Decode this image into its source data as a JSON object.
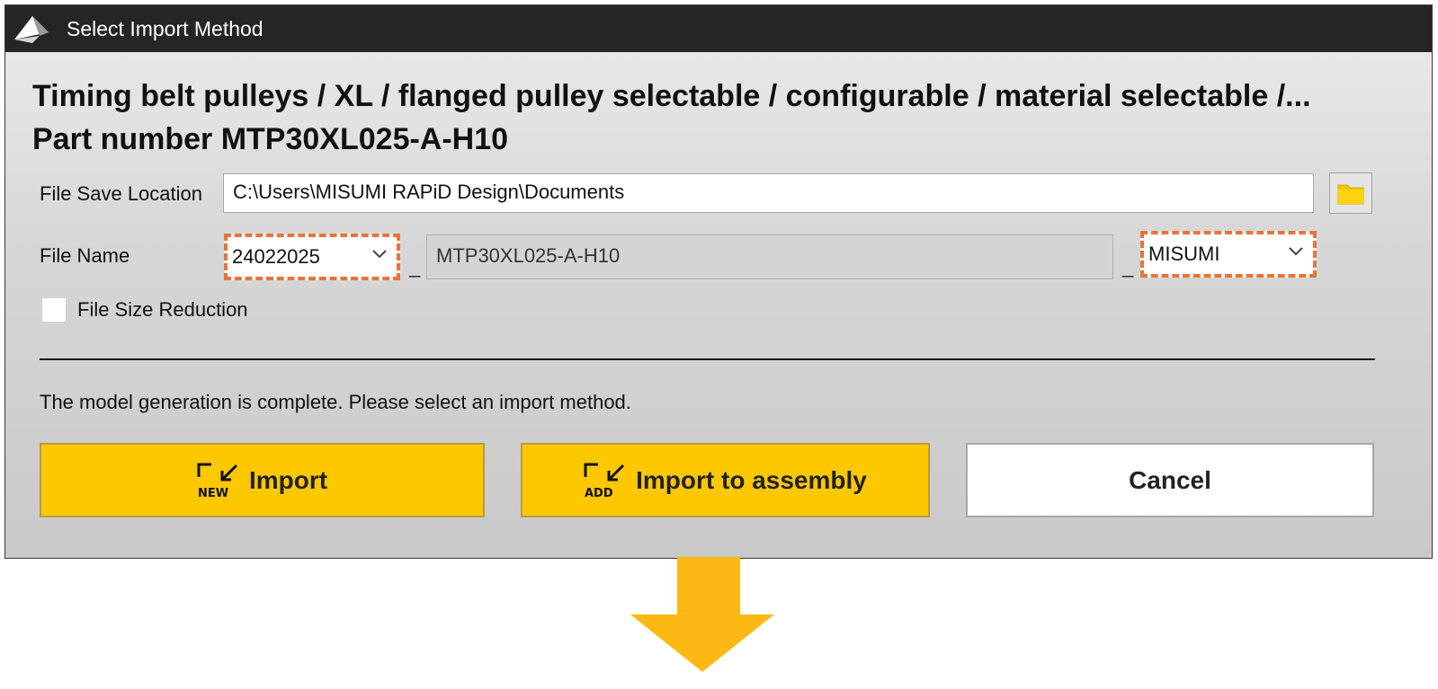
{
  "window": {
    "title": "Select Import Method",
    "logo_icon": "misumi-logo-icon"
  },
  "heading": {
    "line1": "Timing belt pulleys / XL / flanged pulley selectable / configurable / material selectable /...",
    "line2": "Part number MTP30XL025-A-H10"
  },
  "form": {
    "save_location_label": "File Save Location",
    "save_location_value": "C:\\Users\\MISUMI RAPiD Design\\Documents",
    "browse_icon": "folder-icon",
    "file_name_label": "File Name",
    "prefix_value": "24022025",
    "separator": "_",
    "part_number_value": "MTP30XL025-A-H10",
    "suffix_value": "MISUMI",
    "file_size_reduction_label": "File Size Reduction",
    "file_size_reduction_checked": false
  },
  "status_message": "The model generation is complete. Please select an import method.",
  "buttons": {
    "import": {
      "label": "Import",
      "icon": "import-new-icon",
      "icon_text": "NEW"
    },
    "import_assembly": {
      "label": "Import to assembly",
      "icon": "import-add-icon",
      "icon_text": "ADD"
    },
    "cancel": {
      "label": "Cancel"
    }
  },
  "colors": {
    "accent_yellow": "#fec801",
    "highlight_dash": "#e8743b",
    "titlebar": "#252525",
    "arrow": "#fdb913"
  }
}
